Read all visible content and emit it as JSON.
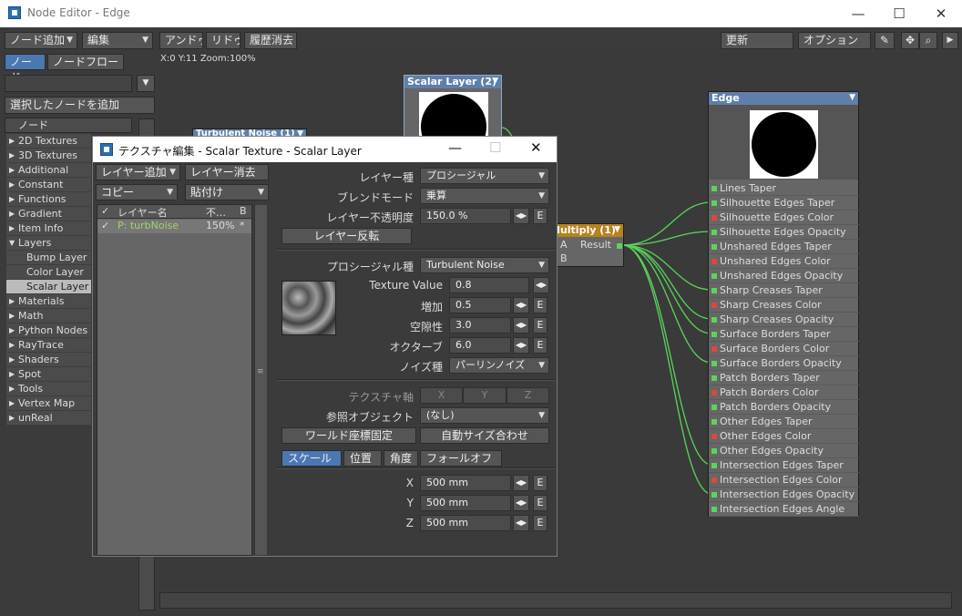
{
  "window": {
    "title": "Node Editor - Edge",
    "min": "—",
    "max": "☐",
    "close": "✕"
  },
  "toolbar": {
    "add_node": "ノード追加",
    "edit": "編集",
    "undo": "アンドゥ",
    "redo": "リドゥ",
    "clear_history": "履歴消去",
    "update": "更新",
    "options": "オプション"
  },
  "left": {
    "tab_nodes": "ノード",
    "tab_flow": "ノードフロー",
    "add_selected": "選択したノードを追加",
    "list_header": "ノード",
    "items": [
      "2D Textures",
      "3D Textures",
      "Additional",
      "Constant",
      "Functions",
      "Gradient",
      "Item Info",
      "Layers",
      "Bump Layer",
      "Color Layer",
      "Scalar Layer",
      "Materials",
      "Math",
      "Python Nodes",
      "RayTrace",
      "Shaders",
      "Spot",
      "Tools",
      "Vertex Map",
      "unReal"
    ]
  },
  "canvas": {
    "coords": "X:0 Y:11 Zoom:100%"
  },
  "nodes": {
    "scalar_layer": "Scalar Layer (2)",
    "turbulent": "Turbulent Noise (1)",
    "multiply": "Multiply (1)",
    "multiply_a": "A",
    "multiply_b": "B",
    "multiply_result": "Result",
    "edge": "Edge"
  },
  "edge_ports": [
    {
      "label": "Lines Taper",
      "color": "#5bd45b"
    },
    {
      "label": "Silhouette Edges Taper",
      "color": "#5bd45b"
    },
    {
      "label": "Silhouette Edges Color",
      "color": "#d84a3e"
    },
    {
      "label": "Silhouette Edges Opacity",
      "color": "#5bd45b"
    },
    {
      "label": "Unshared Edges Taper",
      "color": "#5bd45b"
    },
    {
      "label": "Unshared Edges Color",
      "color": "#d84a3e"
    },
    {
      "label": "Unshared Edges Opacity",
      "color": "#5bd45b"
    },
    {
      "label": "Sharp Creases Taper",
      "color": "#5bd45b"
    },
    {
      "label": "Sharp Creases Color",
      "color": "#d84a3e"
    },
    {
      "label": "Sharp Creases Opacity",
      "color": "#5bd45b"
    },
    {
      "label": "Surface Borders Taper",
      "color": "#5bd45b"
    },
    {
      "label": "Surface Borders Color",
      "color": "#d84a3e"
    },
    {
      "label": "Surface Borders Opacity",
      "color": "#5bd45b"
    },
    {
      "label": "Patch Borders Taper",
      "color": "#5bd45b"
    },
    {
      "label": "Patch Borders Color",
      "color": "#d84a3e"
    },
    {
      "label": "Patch Borders Opacity",
      "color": "#5bd45b"
    },
    {
      "label": "Other Edges Taper",
      "color": "#5bd45b"
    },
    {
      "label": "Other Edges Color",
      "color": "#d84a3e"
    },
    {
      "label": "Other Edges Opacity",
      "color": "#5bd45b"
    },
    {
      "label": "Intersection Edges Taper",
      "color": "#5bd45b"
    },
    {
      "label": "Intersection Edges Color",
      "color": "#d84a3e"
    },
    {
      "label": "Intersection Edges Opacity",
      "color": "#5bd45b"
    },
    {
      "label": "Intersection Edges Angle",
      "color": "#5bd45b"
    }
  ],
  "connected_ports": [
    1,
    3,
    7,
    9,
    10,
    12,
    19,
    21
  ],
  "dialog": {
    "title": "テクスチャ編集 - Scalar Texture - Scalar Layer",
    "add_layer": "レイヤー追加",
    "delete_layer": "レイヤー消去",
    "copy": "コピー",
    "paste": "貼付け",
    "col_name": "レイヤー名",
    "col_opacity": "不…",
    "col_b": "B",
    "row_name": "P: turbNoise",
    "row_opacity": "150%",
    "row_b": "*",
    "layer_type_label": "レイヤー種",
    "layer_type": "プロシージャル",
    "blend_label": "ブレンドモード",
    "blend": "乗算",
    "opacity_label": "レイヤー不透明度",
    "opacity": "150.0 %",
    "invert": "レイヤー反転",
    "proc_type_label": "プロシージャル種",
    "proc_type": "Turbulent Noise",
    "texval_label": "Texture Value",
    "texval": "0.8",
    "increase_label": "増加",
    "increase": "0.5",
    "lacunarity_label": "空隙性",
    "lacunarity": "3.0",
    "octave_label": "オクターブ",
    "octave": "6.0",
    "noise_label": "ノイズ種",
    "noise": "パーリンノイズ",
    "axis_label": "テクスチャ軸",
    "axis_x": "X",
    "axis_y": "Y",
    "axis_z": "Z",
    "ref_label": "参照オブジェクト",
    "ref": "(なし)",
    "world_coords": "ワールド座標固定",
    "auto_size": "自動サイズ合わせ",
    "tab_scale": "スケール",
    "tab_pos": "位置",
    "tab_angle": "角度",
    "tab_falloff": "フォールオフ",
    "x_label": "X",
    "x": "500 mm",
    "y_label": "Y",
    "y": "500 mm",
    "z_label": "Z",
    "z": "500 mm",
    "env": "E",
    "arrows": "◀▶"
  }
}
